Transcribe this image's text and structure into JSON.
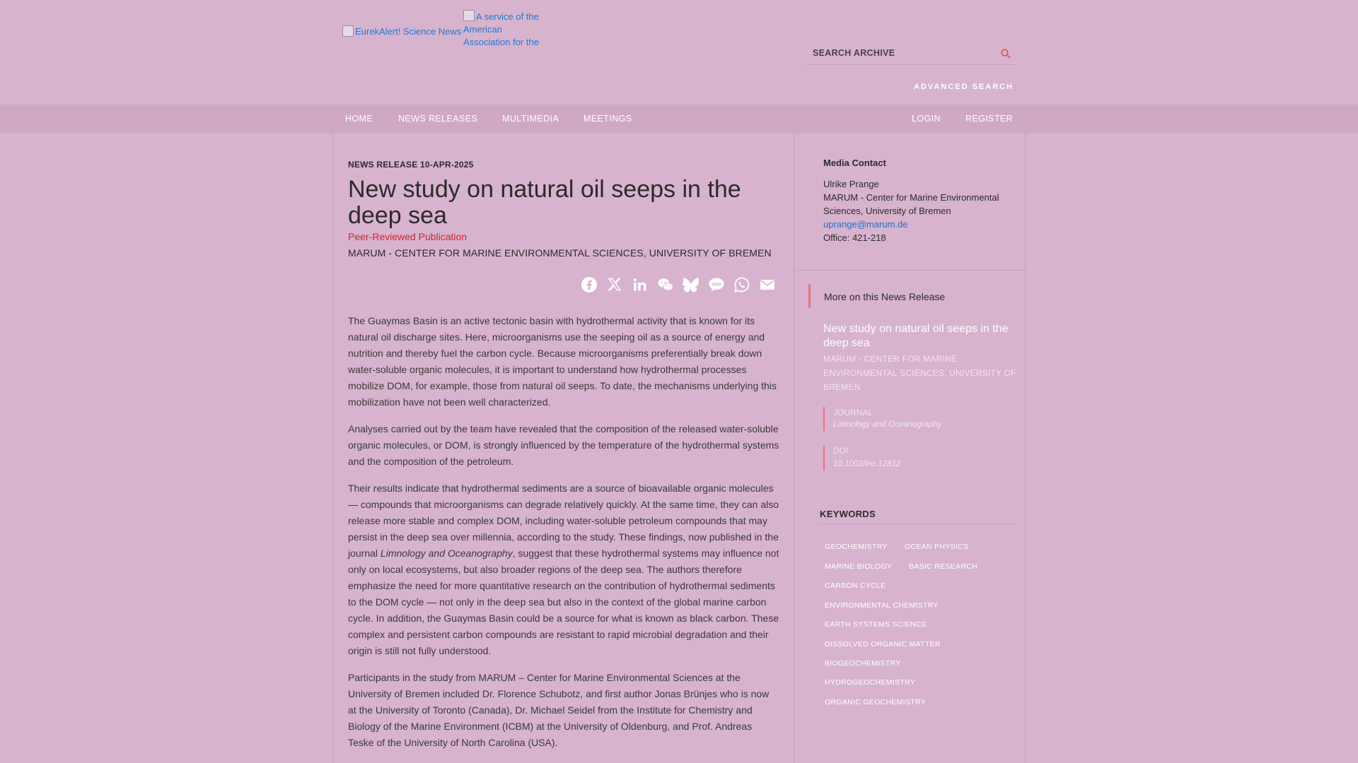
{
  "header": {
    "logo_alt": "EurekAlert! Science News",
    "service_alt": "A service of the American Association for the",
    "search_placeholder": "SEARCH ARCHIVE",
    "advanced_search": "ADVANCED SEARCH"
  },
  "nav": {
    "home": "HOME",
    "news_releases": "NEWS RELEASES",
    "multimedia": "MULTIMEDIA",
    "meetings": "MEETINGS",
    "login": "LOGIN",
    "register": "REGISTER"
  },
  "article": {
    "meta": "NEWS RELEASE 10-APR-2025",
    "title": "New study on natural oil seeps in the deep sea",
    "peer_reviewed": "Peer-Reviewed Publication",
    "institution": "MARUM - CENTER FOR MARINE ENVIRONMENTAL SCIENCES, UNIVERSITY OF BREMEN",
    "share_icons": [
      "facebook-icon",
      "x-icon",
      "linkedin-icon",
      "wechat-icon",
      "bluesky-icon",
      "sms-icon",
      "whatsapp-icon",
      "email-icon"
    ],
    "p1": "The Guaymas Basin is an active tectonic basin with hydrothermal activity that is known for its natural oil discharge sites. Here, microorganisms use the seeping oil as a source of energy and nutrition and thereby fuel the carbon cycle. Because microorganisms preferentially break down water-soluble organic molecules, it is important to understand how hydrothermal processes mobilize DOM, for example, those from natural oil seeps. To date, the mechanisms underlying this mobilization have not been well characterized.",
    "p2": "Analyses carried out by the team have revealed that the composition of the released water-soluble organic molecules, or DOM, is strongly influenced by the temperature of the hydrothermal systems and the composition of the petroleum.",
    "p3_a": "Their results indicate that hydrothermal sediments are a source of bioavailable organic molecules — compounds that microorganisms can degrade relatively quickly. At the same time, they can also release more stable and complex DOM, including water-soluble petroleum compounds that may persist in the deep sea over millennia, according to the study. These findings, now published in the journal ",
    "p3_journal": "Limnology and Oceanography",
    "p3_b": ", suggest that these hydrothermal systems may influence not only on local ecosystems, but also broader regions of the deep sea. The authors therefore emphasize the need for more quantitative research on the contribution of hydrothermal sediments to the DOM cycle — not only in the deep sea but also in the context of the global marine carbon cycle. In addition, the Guaymas Basin could be a source for what is known as black carbon. These complex and persistent carbon compounds are resistant to rapid microbial degradation and their origin is still not fully understood.",
    "p4": "Participants in the study from MARUM – Center for Marine Environmental Sciences at the University of Bremen included Dr. Florence Schubotz, and first author Jonas Brünjes who is now at the University of Toronto (Canada), Dr. Michael Seidel from the Institute for Chemistry and Biology of the Marine Environment (ICBM) at the University of Oldenburg, and Prof. Andreas Teske of the University of North Carolina (USA)."
  },
  "sidebar": {
    "media_contact_title": "Media Contact",
    "contact_name": "Ulrike Prange",
    "contact_org": "MARUM - Center for Marine Environmental Sciences, University of Bremen",
    "contact_email": "uprange@marum.de",
    "contact_office": "Office: 421-218",
    "more_label": "More on this News Release",
    "release_title": "New study on natural oil seeps in the deep sea",
    "release_institution": "MARUM - CENTER FOR MARINE ENVIRONMENTAL SCIENCES, UNIVERSITY OF BREMEN",
    "journal_label": "JOURNAL",
    "journal_value": "Limnology and Oceanography",
    "doi_label": "DOI",
    "doi_value": "10.1002/lno.12812",
    "keywords_title": "KEYWORDS",
    "keywords": [
      "GEOCHEMISTRY",
      "OCEAN PHYSICS",
      "MARINE BIOLOGY",
      "BASIC RESEARCH",
      "CARBON CYCLE",
      "ENVIRONMENTAL CHEMISTRY",
      "EARTH SYSTEMS SCIENCE",
      "DISSOLVED ORGANIC MATTER",
      "BIOGEOCHEMISTRY",
      "HYDROGEOCHEMISTRY",
      "ORGANIC GEOCHEMISTRY"
    ]
  },
  "colors": {
    "background": "#d7b3cd",
    "nav_bar": "#cfa9c3",
    "accent_red": "#d8242c",
    "link_blue": "#1f6fc8"
  }
}
